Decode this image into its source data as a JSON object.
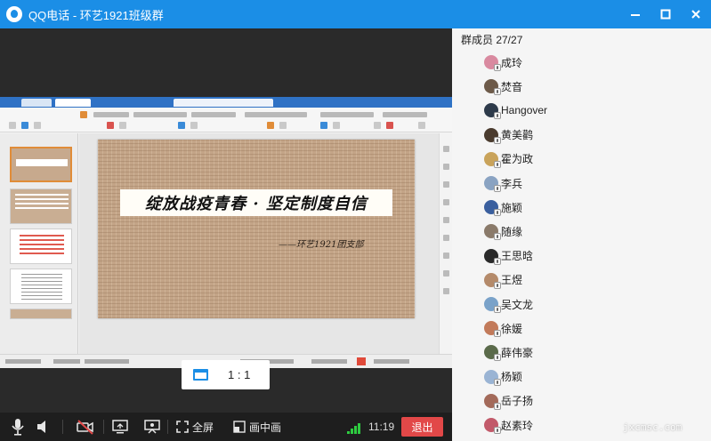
{
  "window": {
    "title": "QQ电话 - 环艺1921班级群"
  },
  "slide": {
    "title": "绽放战疫青春 · 坚定制度自信",
    "subtitle": "——环艺1921团支部"
  },
  "view": {
    "ratio_label": "1 : 1"
  },
  "toolbar": {
    "fullscreen_label": "全屏",
    "pip_label": "画中画",
    "time": "11:19",
    "exit_label": "退出"
  },
  "members": {
    "header": "群成员 27/27",
    "list": [
      {
        "name": "成玲",
        "avatar_color": "#d98aa0"
      },
      {
        "name": "焚音",
        "avatar_color": "#6d5a49"
      },
      {
        "name": "Hangover",
        "avatar_color": "#2d3a4a"
      },
      {
        "name": "黄美鹳",
        "avatar_color": "#4a3b2e"
      },
      {
        "name": "霍为政",
        "avatar_color": "#c9a35a"
      },
      {
        "name": "李兵",
        "avatar_color": "#8aa3c2"
      },
      {
        "name": "施颖",
        "avatar_color": "#3a5f9e"
      },
      {
        "name": "随缘",
        "avatar_color": "#8a7a6a"
      },
      {
        "name": "王思晗",
        "avatar_color": "#2a2a2a"
      },
      {
        "name": "王煜",
        "avatar_color": "#b48a6a"
      },
      {
        "name": "吴文龙",
        "avatar_color": "#7aa2c9"
      },
      {
        "name": "徐媛",
        "avatar_color": "#c27a5a"
      },
      {
        "name": "薛伟豪",
        "avatar_color": "#5a6a4a"
      },
      {
        "name": "杨颖",
        "avatar_color": "#9ab4d4"
      },
      {
        "name": "岳子扬",
        "avatar_color": "#a36a5a"
      },
      {
        "name": "赵素玲",
        "avatar_color": "#c25a6a"
      }
    ]
  },
  "watermark": "jxcmsc.com",
  "colors": {
    "accent": "#1b8ee6",
    "exit": "#e24848",
    "signal": "#2ecc40"
  }
}
